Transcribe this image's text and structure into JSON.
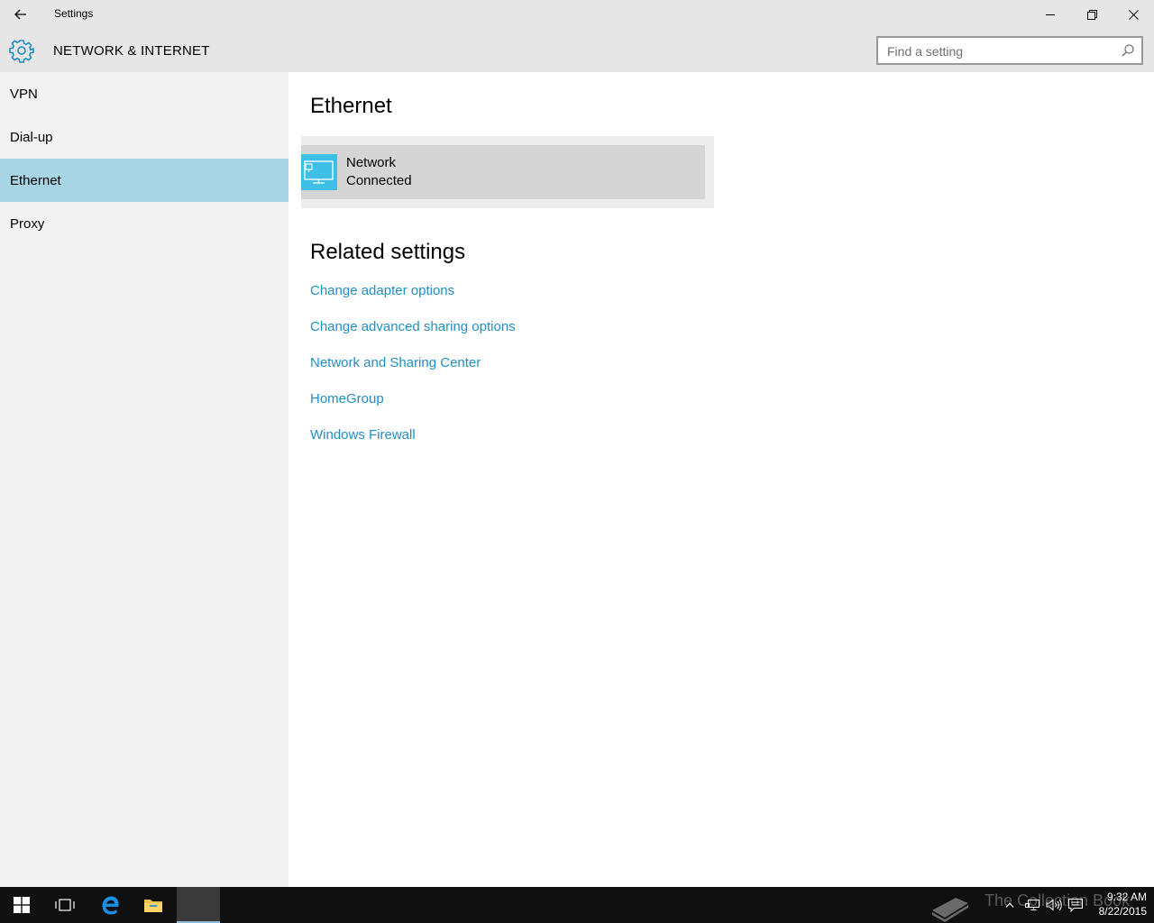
{
  "window": {
    "title": "Settings"
  },
  "header": {
    "section_title": "NETWORK & INTERNET",
    "search_placeholder": "Find a setting"
  },
  "sidebar": {
    "items": [
      {
        "label": "VPN",
        "active": false
      },
      {
        "label": "Dial-up",
        "active": false
      },
      {
        "label": "Ethernet",
        "active": true
      },
      {
        "label": "Proxy",
        "active": false
      }
    ]
  },
  "main": {
    "title": "Ethernet",
    "network": {
      "name": "Network",
      "status": "Connected",
      "icon": "ethernet-monitor-icon"
    },
    "related_title": "Related settings",
    "links": [
      "Change adapter options",
      "Change advanced sharing options",
      "Network and Sharing Center",
      "HomeGroup",
      "Windows Firewall"
    ]
  },
  "taskbar": {
    "watermark": "The Collection Book",
    "time": "9:32 AM",
    "date": "8/22/2015"
  },
  "colors": {
    "accent": "#3ebfe5",
    "selected_nav": "#a7d5e4",
    "link": "#1e8fc4",
    "taskbar": "#101010"
  }
}
